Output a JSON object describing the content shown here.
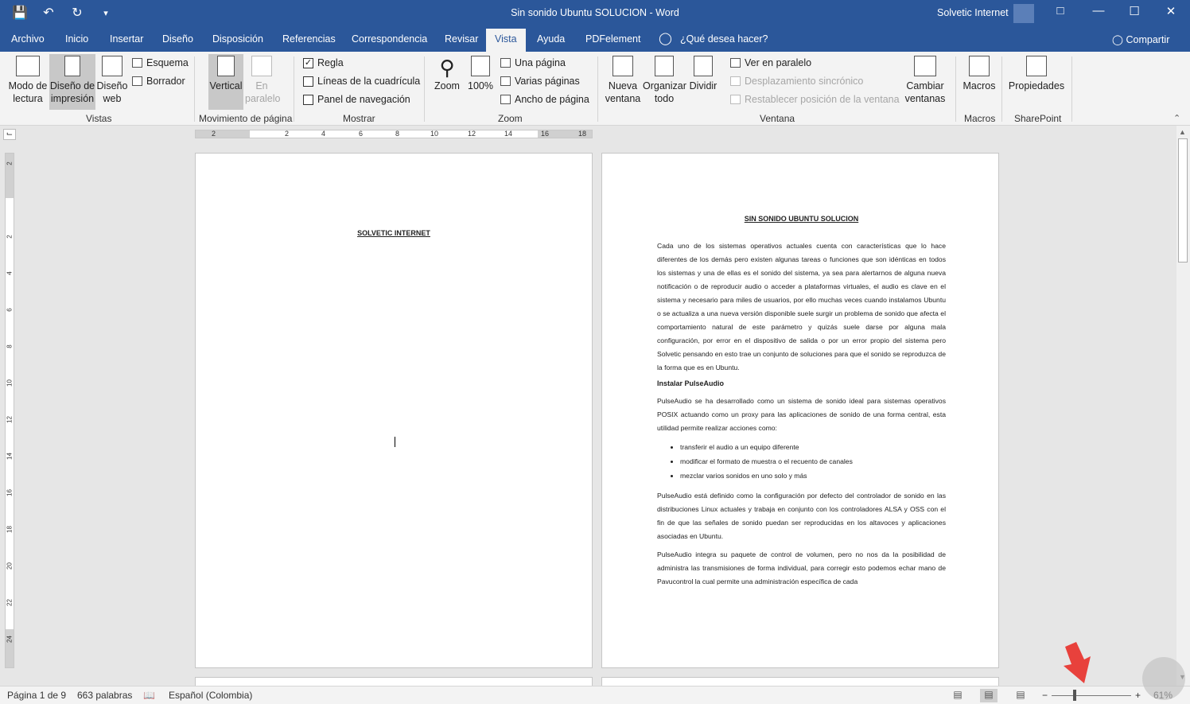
{
  "titlebar": {
    "title": "Sin sonido Ubuntu SOLUCION  -  Word",
    "user": "Solvetic Internet",
    "qat_icons": [
      "save-icon",
      "undo-icon",
      "redo-icon",
      "customize-icon"
    ]
  },
  "tabs": [
    "Archivo",
    "Inicio",
    "Insertar",
    "Diseño",
    "Disposición",
    "Referencias",
    "Correspondencia",
    "Revisar",
    "Vista",
    "Ayuda",
    "PDFelement"
  ],
  "active_tab": "Vista",
  "tell_me": "¿Qué desea hacer?",
  "share": "Compartir",
  "ribbon": {
    "vistas": {
      "label": "Vistas",
      "modo_lectura": "Modo de lectura",
      "diseno_impresion": "Diseño de impresión",
      "diseno_web": "Diseño web",
      "esquema": "Esquema",
      "borrador": "Borrador"
    },
    "movimiento": {
      "label": "Movimiento de página",
      "vertical": "Vertical",
      "paralelo": "En paralelo"
    },
    "mostrar": {
      "label": "Mostrar",
      "regla": "Regla",
      "lineas": "Líneas de la cuadrícula",
      "panel": "Panel de navegación",
      "regla_checked": true
    },
    "zoom": {
      "label": "Zoom",
      "zoom": "Zoom",
      "cien": "100%",
      "una": "Una página",
      "varias": "Varias páginas",
      "ancho": "Ancho de página"
    },
    "ventana": {
      "label": "Ventana",
      "nueva": "Nueva ventana",
      "organizar": "Organizar todo",
      "dividir": "Dividir",
      "ver_paralelo": "Ver en paralelo",
      "desplazamiento": "Desplazamiento sincrónico",
      "restablecer": "Restablecer posición de la ventana",
      "cambiar": "Cambiar ventanas"
    },
    "macros": {
      "label": "Macros",
      "macros": "Macros"
    },
    "sharepoint": {
      "label": "SharePoint",
      "propiedades": "Propiedades"
    }
  },
  "ruler": {
    "h_ticks": [
      "2",
      "2",
      "4",
      "6",
      "8",
      "10",
      "12",
      "14",
      "16",
      "18"
    ],
    "v_ticks": [
      "2",
      "2",
      "4",
      "6",
      "8",
      "10",
      "12",
      "14",
      "16",
      "18",
      "20",
      "22",
      "24"
    ]
  },
  "page1": {
    "title": "SOLVETIC INTERNET"
  },
  "page2": {
    "title": "SIN SONIDO UBUNTU SOLUCION",
    "p1": "Cada uno de los sistemas operativos actuales cuenta con características que lo hace diferentes de los demás pero existen algunas tareas o funciones que son idénticas en todos los sistemas y una de ellas es el sonido del sistema, ya sea para alertarnos de alguna nueva notificación o de reproducir audio o acceder a plataformas virtuales, el audio es clave en el sistema y necesario para miles de usuarios, por ello muchas veces cuando instalamos Ubuntu o se actualiza a una nueva versión disponible suele surgir un problema de sonido que afecta el comportamiento natural de este parámetro y quizás suele darse por alguna mala configuración, por error en el dispositivo de salida o por un error propio del sistema pero Solvetic pensando en esto trae un conjunto de soluciones para que el sonido se reproduzca de la forma que es en Ubuntu.",
    "h2": "Instalar PulseAudio",
    "p2": "PulseAudio se ha desarrollado como un sistema de sonido ideal para sistemas operativos POSIX actuando como un proxy para las aplicaciones de sonido de una forma central, esta utilidad permite realizar acciones como:",
    "bullets": [
      "transferir el audio a un equipo diferente",
      "modificar el formato de muestra o el recuento de canales",
      "mezclar varios sonidos en uno solo y más"
    ],
    "p3": "PulseAudio está definido como la configuración por defecto del controlador de sonido en las distribuciones Linux actuales y trabaja en conjunto con los controladores ALSA y OSS con el fin de que las señales de sonido puedan ser reproducidas en los altavoces y aplicaciones asociadas en Ubuntu.",
    "p4": "PulseAudio integra su paquete de control de volumen, pero no nos da la posibilidad de  administra las transmisiones de forma individual, para corregir esto podemos echar mano de Pavucontrol la cual permite una administración específica de cada"
  },
  "status": {
    "pagina": "Página 1 de 9",
    "palabras": "663 palabras",
    "idioma": "Español (Colombia)",
    "zoom": "61%",
    "zoom_level": 0.61
  },
  "colors": {
    "accent": "#2b579a",
    "arrow": "#e8413c"
  }
}
